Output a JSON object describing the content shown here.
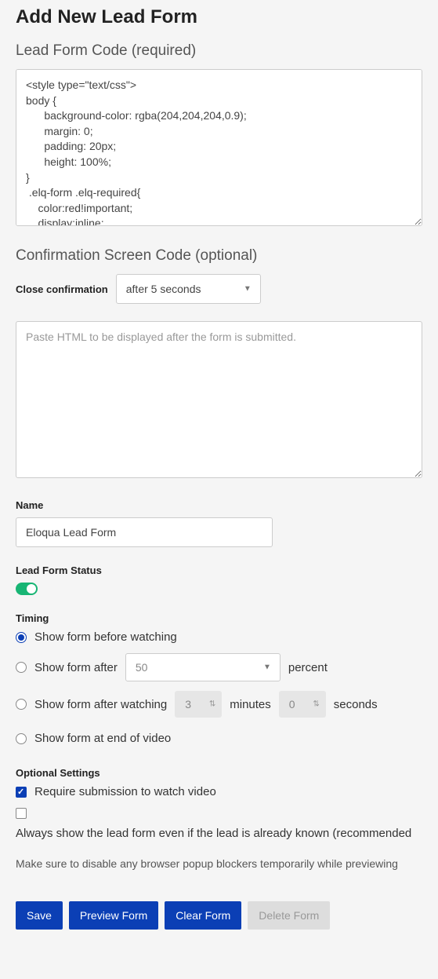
{
  "title": "Add New Lead Form",
  "sections": {
    "lead_form_code": {
      "heading": "Lead Form Code (required)",
      "value": "<style type=\"text/css\">\nbody {\n      background-color: rgba(204,204,204,0.9);\n      margin: 0;\n      padding: 20px;\n      height: 100%;\n}\n .elq-form .elq-required{\n    color:red!important;\n    display:inline;\n    float:none;"
    },
    "confirmation": {
      "heading": "Confirmation Screen Code (optional)",
      "close_label": "Close confirmation",
      "close_value": "after 5 seconds",
      "placeholder": "Paste HTML to be displayed after the form is submitted."
    },
    "name": {
      "label": "Name",
      "value": "Eloqua Lead Form"
    },
    "status": {
      "label": "Lead Form Status",
      "on": true
    },
    "timing": {
      "label": "Timing",
      "options": {
        "before": "Show form before watching",
        "percent_prefix": "Show form after",
        "percent_value": "50",
        "percent_suffix": "percent",
        "watching_prefix": "Show form after watching",
        "minutes_value": "3",
        "minutes_label": "minutes",
        "seconds_value": "0",
        "seconds_label": "seconds",
        "end": "Show form at end of video"
      },
      "selected": "before"
    },
    "optional": {
      "label": "Optional Settings",
      "require_submission": "Require submission to watch video",
      "always_show": "Always show the lead form even if the lead is already known (recommended"
    },
    "note": "Make sure to disable any browser popup blockers temporarily while previewing"
  },
  "buttons": {
    "save": "Save",
    "preview": "Preview Form",
    "clear": "Clear Form",
    "delete": "Delete Form"
  }
}
